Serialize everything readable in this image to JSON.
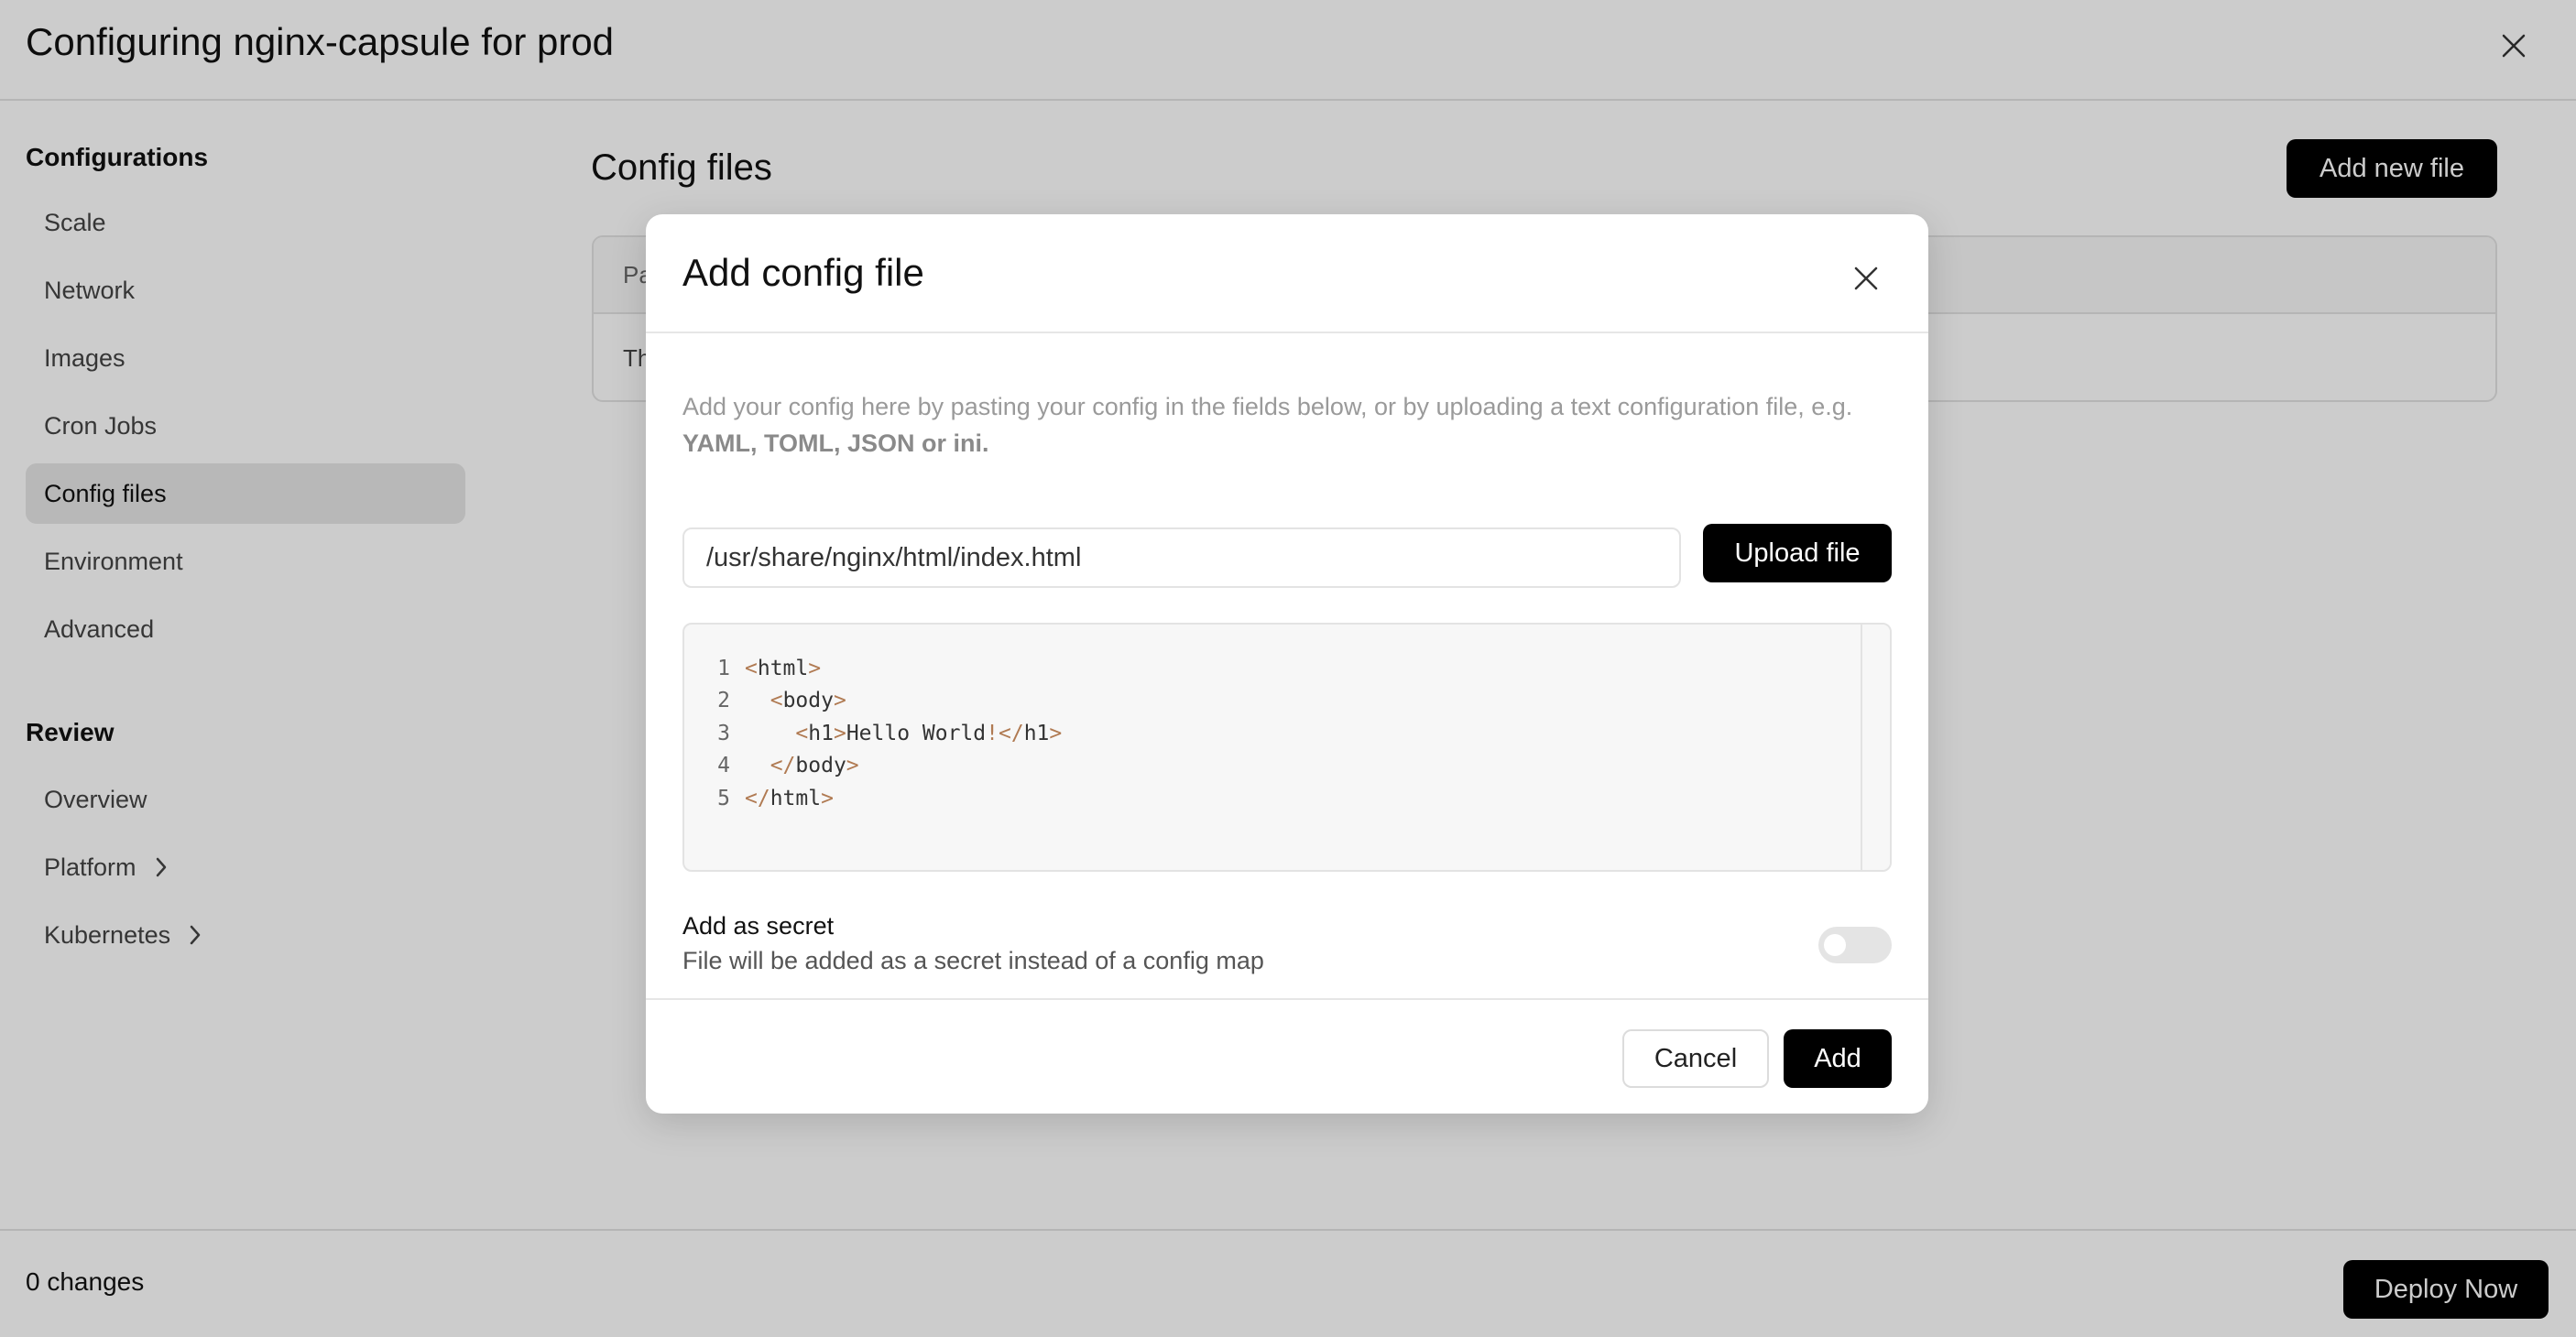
{
  "app": {
    "title": "Configuring nginx-capsule for prod"
  },
  "sidebar": {
    "sections": [
      {
        "heading": "Configurations",
        "items": [
          {
            "label": "Scale"
          },
          {
            "label": "Network"
          },
          {
            "label": "Images"
          },
          {
            "label": "Cron Jobs"
          },
          {
            "label": "Config files",
            "active": true
          },
          {
            "label": "Environment"
          },
          {
            "label": "Advanced"
          }
        ]
      },
      {
        "heading": "Review",
        "items": [
          {
            "label": "Overview"
          },
          {
            "label": "Platform",
            "icon": "chevron-right-icon"
          },
          {
            "label": "Kubernetes",
            "icon": "chevron-right-icon"
          }
        ]
      }
    ]
  },
  "main": {
    "title": "Config files",
    "add_button": "Add new file",
    "table": {
      "header_visible": "Pa",
      "row_visible": "Th"
    }
  },
  "footer": {
    "changes": "0 changes",
    "deploy_button": "Deploy Now"
  },
  "modal": {
    "title": "Add config file",
    "close_icon": "close-icon",
    "description": "Add your config here by pasting your config in the fields below, or by uploading a text configuration file, e.g.",
    "formats": "YAML, TOML, JSON or ini.",
    "path_value": "/usr/share/nginx/html/index.html",
    "upload_button": "Upload file",
    "editor": {
      "lines": [
        {
          "n": "1",
          "code": "<html>"
        },
        {
          "n": "2",
          "code": "  <body>"
        },
        {
          "n": "3",
          "code": "    <h1>Hello World!</h1>"
        },
        {
          "n": "4",
          "code": "  </body>"
        },
        {
          "n": "5",
          "code": "</html>"
        }
      ]
    },
    "secret": {
      "title": "Add as secret",
      "description": "File will be added as a secret instead of a config map",
      "enabled": false
    },
    "cancel_button": "Cancel",
    "add_button": "Add"
  },
  "colors": {
    "primary_button": "#000000",
    "overlay": "rgba(0,0,0,0.2)",
    "active_nav": "#e6e6e6",
    "code_punctuation": "#b07a52"
  }
}
